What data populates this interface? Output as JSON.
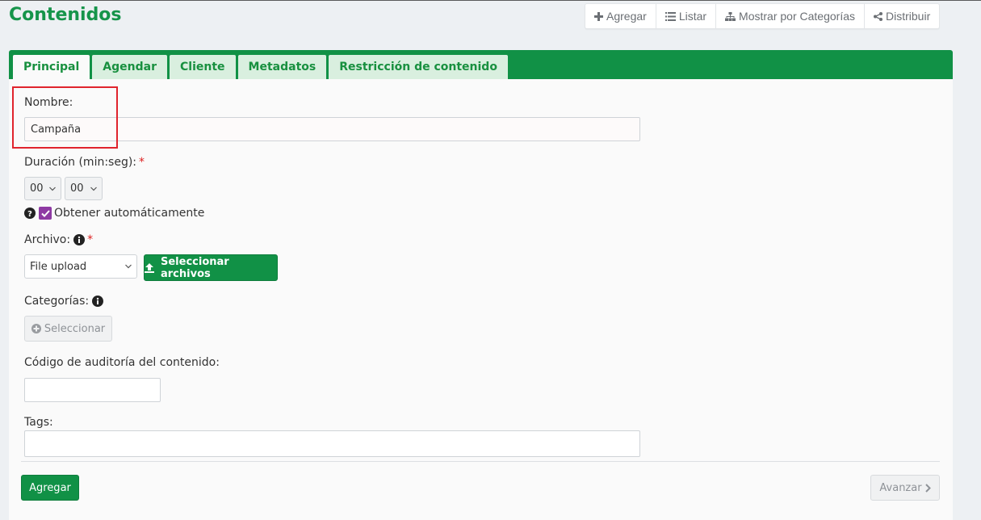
{
  "page": {
    "title": "Contenidos"
  },
  "toolbar": {
    "add_label": "Agregar",
    "list_label": "Listar",
    "categories_label": "Mostrar por Categorías",
    "distribute_label": "Distribuir"
  },
  "tabs": [
    {
      "label": "Principal",
      "active": true
    },
    {
      "label": "Agendar"
    },
    {
      "label": "Cliente"
    },
    {
      "label": "Metadatos"
    },
    {
      "label": "Restricción de contenido"
    }
  ],
  "form": {
    "name_label": "Nombre:",
    "name_value": "Campaña",
    "duration_label": "Duración (min:seg):",
    "required_mark": "*",
    "duration_min": "00",
    "duration_sec": "00",
    "auto_label": "Obtener automáticamente",
    "auto_checked": true,
    "file_label": "Archivo:",
    "file_source": "File upload",
    "select_files_label": "Seleccionar archivos",
    "categories_label": "Categorías:",
    "categories_button": "Seleccionar",
    "audit_label": "Código de auditoría del contenido:",
    "audit_value": "",
    "tags_label": "Tags:",
    "tags_value": ""
  },
  "footer": {
    "submit_label": "Agregar",
    "next_label": "Avanzar"
  },
  "colors": {
    "brand_green": "#119146",
    "title_green": "#16944a",
    "checkbox_purple": "#8e3aa3",
    "highlight_red": "#e0242d"
  }
}
